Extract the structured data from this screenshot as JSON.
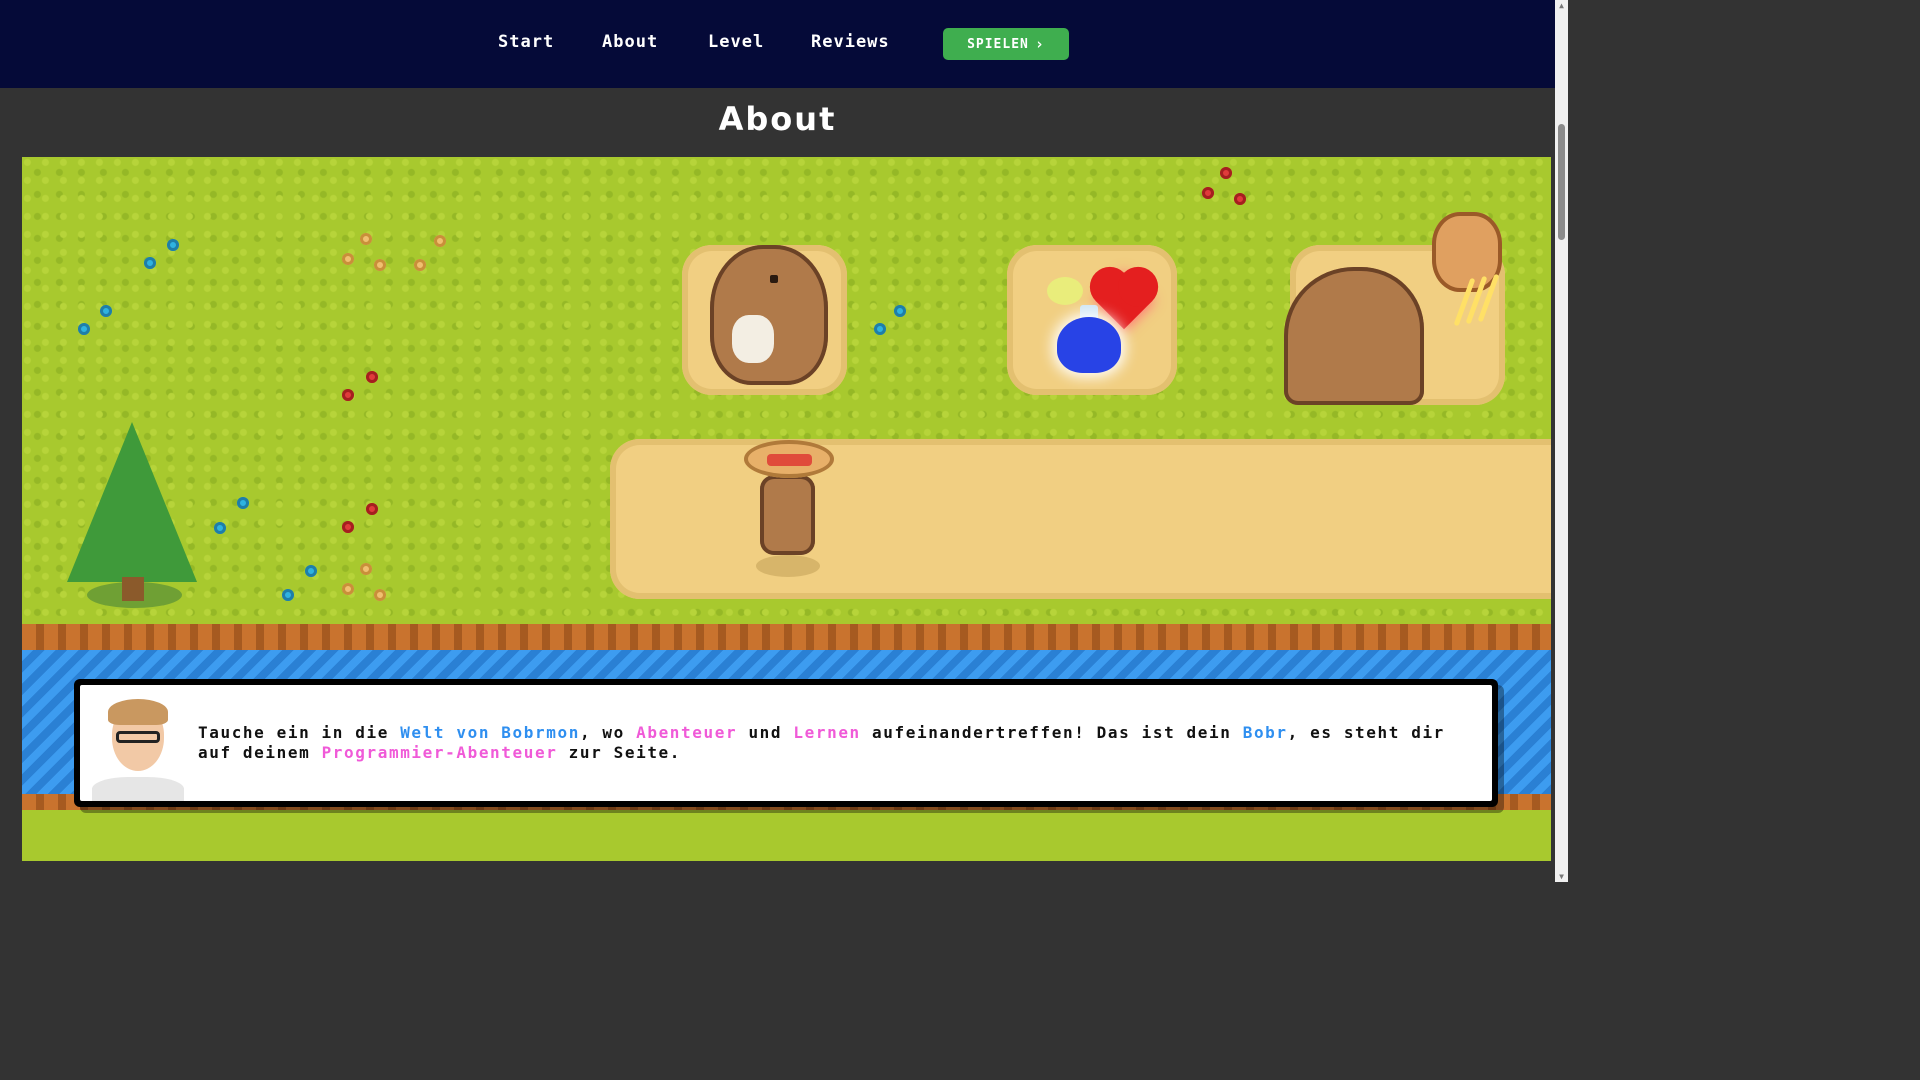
{
  "nav": {
    "links": [
      {
        "label": "Start"
      },
      {
        "label": "About"
      },
      {
        "label": "Level"
      },
      {
        "label": "Reviews"
      }
    ],
    "play_button": {
      "label": "SPIELEN",
      "icon": "chevron-right-icon",
      "color": "#3fae4f"
    },
    "background": "#050a38"
  },
  "section": {
    "title": "About"
  },
  "scene": {
    "sprites": [
      "tree",
      "capybara-bobr",
      "potion-blue",
      "potion-small",
      "heart",
      "capybara-back",
      "armadillo-dragon",
      "hero-with-hat"
    ]
  },
  "dialog": {
    "avatar": "narrator-avatar",
    "segments": [
      {
        "text": "Tauche ein in die ",
        "style": "normal"
      },
      {
        "text": "Welt von Bobrmon",
        "style": "blue"
      },
      {
        "text": ", wo ",
        "style": "normal"
      },
      {
        "text": "Abenteuer",
        "style": "pink"
      },
      {
        "text": " und ",
        "style": "normal"
      },
      {
        "text": "Lernen",
        "style": "pink"
      },
      {
        "text": " aufeinandertreffen! Das ist dein ",
        "style": "normal"
      },
      {
        "text": "Bobr",
        "style": "blue"
      },
      {
        "text": ", es steht dir auf deinem ",
        "style": "normal"
      },
      {
        "text": "Programmier-Abenteuer",
        "style": "pink"
      },
      {
        "text": " zur Seite.",
        "style": "normal"
      }
    ],
    "highlight_colors": {
      "blue": "#2f8ff0",
      "pink": "#f05ad8"
    }
  }
}
